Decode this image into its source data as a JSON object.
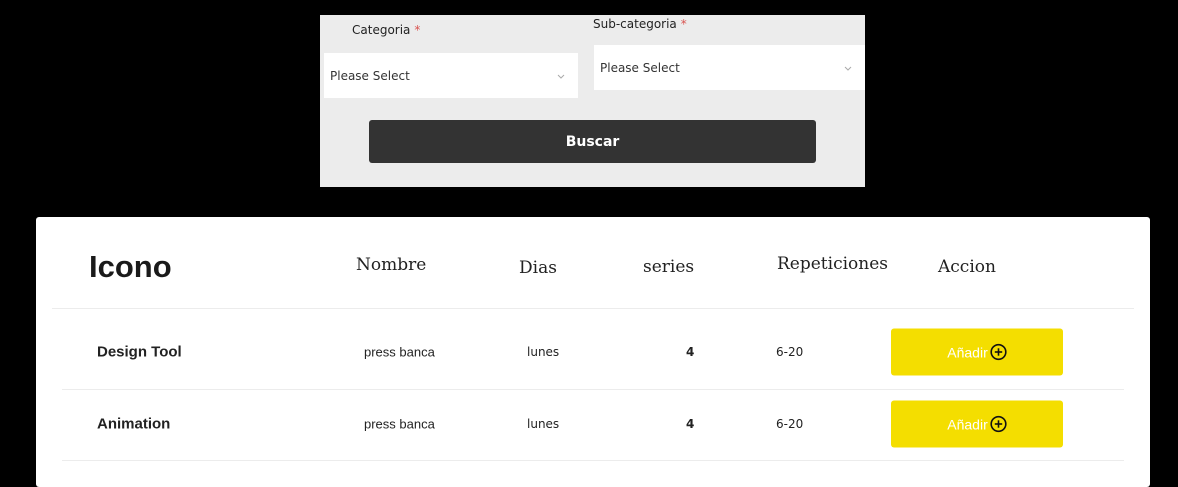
{
  "filters": {
    "categoria_label": "Categoria",
    "subcategoria_label": "Sub-categoria",
    "required_mark": "*",
    "categoria_value": "Please Select",
    "subcategoria_value": "Please Select",
    "search_label": "Buscar"
  },
  "table": {
    "headers": {
      "icono": "Icono",
      "nombre": "Nombre",
      "dias": "Dias",
      "series": "series",
      "repeticiones": "Repeticiones",
      "accion": "Accion"
    },
    "rows": [
      {
        "name": "Design Tool",
        "nombre": "press banca",
        "dias": "lunes",
        "series": "4",
        "repeticiones": "6-20",
        "action_label": "Añadir"
      },
      {
        "name": "Animation",
        "nombre": "press banca",
        "dias": "lunes",
        "series": "4",
        "repeticiones": "6-20",
        "action_label": "Añadir"
      }
    ]
  },
  "colors": {
    "panel_bg": "#ececec",
    "search_button": "#333333",
    "add_button": "#f4de00",
    "required": "#d9534f"
  },
  "icons": {
    "select_chevron": "chevron-down-icon",
    "add": "plus-circle-icon"
  }
}
